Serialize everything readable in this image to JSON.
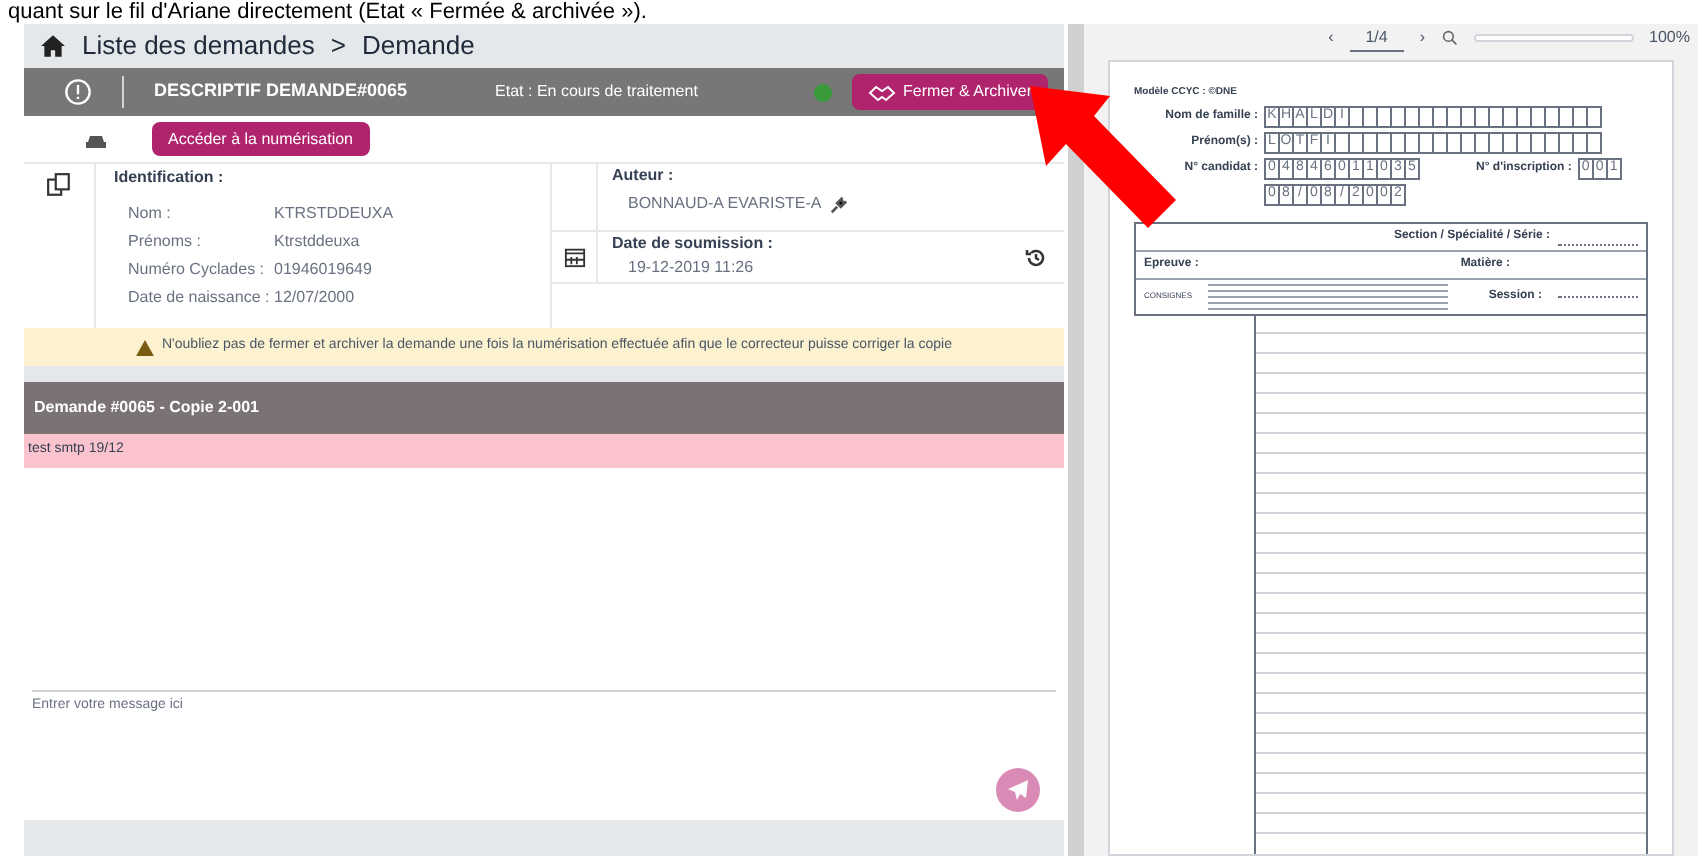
{
  "caption": "quant sur le fil d'Ariane directement (Etat « Fermée & archivée »).",
  "breadcrumb": {
    "items": [
      "Liste des demandes",
      "Demande"
    ],
    "separator": ">"
  },
  "header": {
    "title": "DESCRIPTIF DEMANDE#0065",
    "status": "Etat : En cours de traitement",
    "button": "Fermer & Archiver"
  },
  "scan_button": "Accéder à la numérisation",
  "identification": {
    "title": "Identification :",
    "fields": [
      {
        "label": "Nom :",
        "value": "KTRSTDDEUXA"
      },
      {
        "label": "Prénoms :",
        "value": "Ktrstddeuxa"
      },
      {
        "label": "Numéro Cyclades :",
        "value": "01946019649"
      },
      {
        "label": "Date de naissance :",
        "value": "12/07/2000"
      }
    ]
  },
  "author": {
    "title": "Auteur :",
    "value": "BONNAUD-A EVARISTE-A"
  },
  "submission": {
    "title": "Date de soumission :",
    "value": "19-12-2019 11:26"
  },
  "warning": "N'oubliez pas de fermer et archiver la demande une fois la numérisation effectuée afin que le correcteur puisse corriger la copie",
  "thread": {
    "title": "Demande #0065 - Copie 2-001",
    "messages": [
      "test smtp 19/12"
    ]
  },
  "composer": {
    "placeholder": "Entrer votre message ici"
  },
  "viewer": {
    "previous": "‹",
    "page": "1/4",
    "next": "›",
    "zoom": "100%"
  },
  "form": {
    "model": "Modèle CCYC : ©DNE",
    "rows": [
      {
        "label": "Nom de famille :",
        "chars": [
          "K",
          "H",
          "A",
          "L",
          "D",
          "I"
        ]
      },
      {
        "label": "Prénom(s) :",
        "chars": [
          "L",
          "O",
          "T",
          "F",
          "I"
        ]
      },
      {
        "label": "N° candidat :",
        "chars": [
          "0",
          "4",
          "8",
          "4",
          "6",
          "0",
          "1",
          "1",
          "0",
          "3",
          "5"
        ],
        "extra_label": "N° d'inscription :",
        "extra_chars": [
          "0",
          "0",
          "1"
        ]
      },
      {
        "label": "",
        "chars": [
          "0",
          "8",
          "/",
          "0",
          "8",
          "/",
          "2",
          "0",
          "0",
          "2"
        ]
      }
    ],
    "section": "Section / Spécialité / Série :",
    "epreuve": "Epreuve :",
    "matiere": "Matière :",
    "consignes": "CONSIGNES",
    "session": "Session :"
  }
}
